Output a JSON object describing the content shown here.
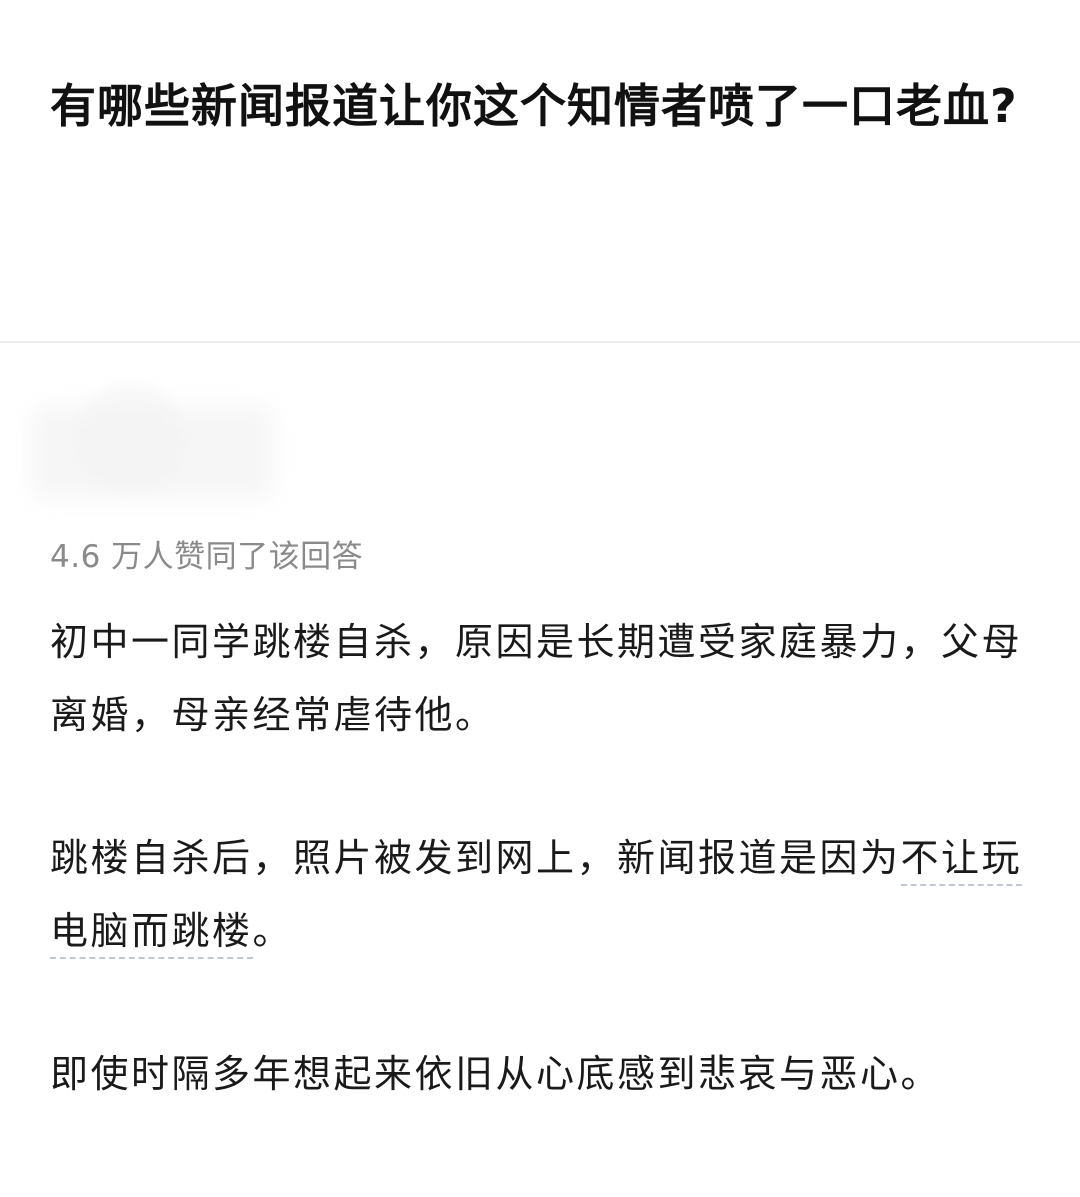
{
  "question": {
    "title": "有哪些新闻报道让你这个知情者喷了一口老血?"
  },
  "answer": {
    "vote_text": "4.6 万人赞同了该回答",
    "paragraphs": [
      {
        "text": "初中一同学跳楼自杀，原因是长期遭受家庭暴力，父母离婚，母亲经常虐待他。"
      },
      {
        "before": "跳楼自杀后，照片被发到网上，新闻报道是因为",
        "keyword": "不让玩电脑而跳楼",
        "after": "。"
      },
      {
        "text": "即使时隔多年想起来依旧从心底感到悲哀与恶心。"
      }
    ]
  },
  "colors": {
    "title": "#111111",
    "body_text": "#1a1a1a",
    "muted_text": "#8a8a8a",
    "divider": "#ececec",
    "keyword_underline": "#bfc6d4"
  }
}
